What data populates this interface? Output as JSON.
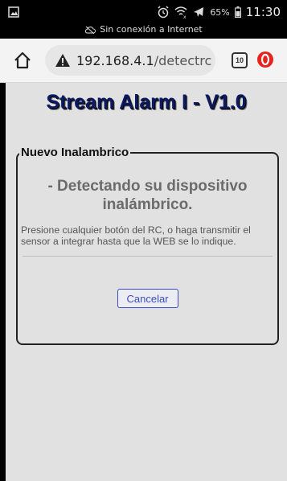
{
  "status_bar": {
    "offline_text": "Sin conexión a Internet",
    "battery_text": "65%",
    "time": "11:30",
    "icons": [
      "gallery-icon",
      "alarm-clock-icon",
      "wifi-off-icon",
      "airplane-mode-icon",
      "battery-icon",
      "cloud-off-icon"
    ]
  },
  "browser": {
    "url_host": "192.168.4.1",
    "url_path": "/detectrc",
    "tab_count": "10",
    "icons": [
      "home-icon",
      "warning-icon",
      "tabs-icon",
      "opera-icon"
    ]
  },
  "page": {
    "title": "Stream Alarm I - V1.0",
    "panel": {
      "legend": "Nuevo Inalambrico",
      "heading": "- Detectando su dispositivo inalámbrico.",
      "instructions": "Presione cualquier botón del RC, o haga transmitir el sensor a integrar hasta que la WEB se lo indique.",
      "cancel_label": "Cancelar"
    }
  },
  "colors": {
    "page_background": "#e1e1e1",
    "title": "#0b1a63",
    "heading": "#6b6b6b",
    "button_accent": "#3d4dbf",
    "opera_red": "#e8231d"
  }
}
